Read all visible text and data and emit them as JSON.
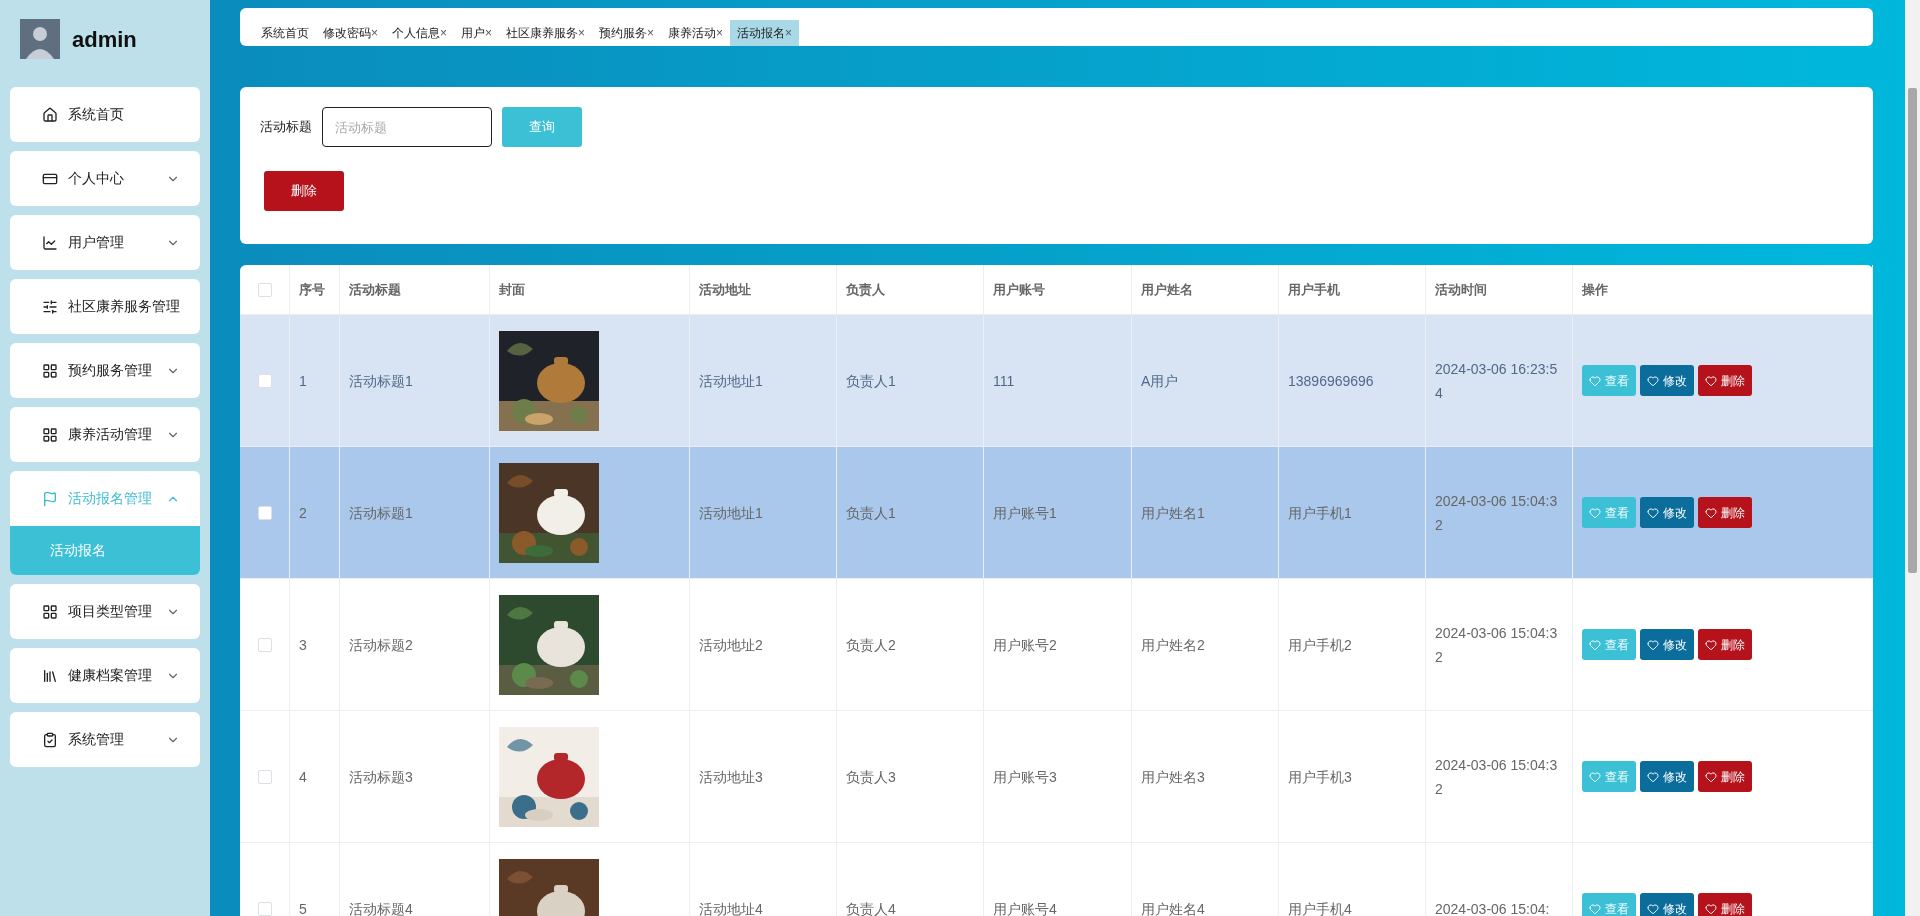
{
  "user": {
    "name": "admin"
  },
  "sidebar": {
    "items": [
      {
        "label": "系统首页",
        "kind": "link",
        "expanded": false
      },
      {
        "label": "个人中心",
        "kind": "menu",
        "expanded": false
      },
      {
        "label": "用户管理",
        "kind": "menu",
        "expanded": false
      },
      {
        "label": "社区康养服务管理",
        "kind": "link",
        "expanded": false
      },
      {
        "label": "预约服务管理",
        "kind": "menu",
        "expanded": false
      },
      {
        "label": "康养活动管理",
        "kind": "menu",
        "expanded": false
      },
      {
        "label": "活动报名管理",
        "kind": "menu",
        "expanded": true,
        "children": [
          {
            "label": "活动报名",
            "selected": true
          }
        ]
      },
      {
        "label": "项目类型管理",
        "kind": "menu",
        "expanded": false
      },
      {
        "label": "健康档案管理",
        "kind": "menu",
        "expanded": false
      },
      {
        "label": "系统管理",
        "kind": "menu",
        "expanded": false
      }
    ]
  },
  "tabs": [
    {
      "label": "系统首页",
      "selected": false
    },
    {
      "label": "修改密码",
      "close": "×",
      "selected": false
    },
    {
      "label": "个人信息",
      "close": "×",
      "selected": false
    },
    {
      "label": "用户",
      "close": "×",
      "selected": false
    },
    {
      "label": "社区康养服务",
      "close": "×",
      "selected": false
    },
    {
      "label": "预约服务",
      "close": "×",
      "selected": false
    },
    {
      "label": "康养活动",
      "close": "×",
      "selected": false
    },
    {
      "label": "活动报名",
      "close": "×",
      "selected": true
    }
  ],
  "search": {
    "label": "活动标题",
    "placeholder": "活动标题",
    "button": "查询",
    "delete_button": "删除"
  },
  "table": {
    "columns": [
      "序号",
      "活动标题",
      "封面",
      "活动地址",
      "负责人",
      "用户账号",
      "用户姓名",
      "用户手机",
      "活动时间",
      "操作"
    ],
    "header_checked": false,
    "rows": [
      {
        "checked": false,
        "hovered": true,
        "selected": false,
        "cells": [
          "1",
          "活动标题1",
          "",
          "活动地址1",
          "负责人1",
          "111",
          "A用户",
          "13896969696",
          "2024-03-06 16:23:54"
        ],
        "cover": {
          "kind": "picture"
        },
        "actions": [
          {
            "kind": "view",
            "label": "查看"
          },
          {
            "kind": "edit",
            "label": "修改"
          },
          {
            "kind": "delete",
            "label": "删除"
          }
        ]
      },
      {
        "checked": false,
        "hovered": false,
        "selected": true,
        "cells": [
          "2",
          "活动标题1",
          "",
          "活动地址1",
          "负责人1",
          "用户账号1",
          "用户姓名1",
          "用户手机1",
          "2024-03-06 15:04:32"
        ],
        "cover": {
          "kind": "picture"
        },
        "actions": [
          {
            "kind": "view",
            "label": "查看"
          },
          {
            "kind": "edit",
            "label": "修改"
          },
          {
            "kind": "delete",
            "label": "删除"
          }
        ]
      },
      {
        "checked": false,
        "hovered": false,
        "selected": false,
        "cells": [
          "3",
          "活动标题2",
          "",
          "活动地址2",
          "负责人2",
          "用户账号2",
          "用户姓名2",
          "用户手机2",
          "2024-03-06 15:04:32"
        ],
        "cover": {
          "kind": "picture"
        },
        "actions": [
          {
            "kind": "view",
            "label": "查看"
          },
          {
            "kind": "edit",
            "label": "修改"
          },
          {
            "kind": "delete",
            "label": "删除"
          }
        ]
      },
      {
        "checked": false,
        "hovered": false,
        "selected": false,
        "cells": [
          "4",
          "活动标题3",
          "",
          "活动地址3",
          "负责人3",
          "用户账号3",
          "用户姓名3",
          "用户手机3",
          "2024-03-06 15:04:32"
        ],
        "cover": {
          "kind": "picture"
        },
        "actions": [
          {
            "kind": "view",
            "label": "查看"
          },
          {
            "kind": "edit",
            "label": "修改"
          },
          {
            "kind": "delete",
            "label": "删除"
          }
        ]
      },
      {
        "checked": false,
        "hovered": false,
        "selected": false,
        "cells": [
          "5",
          "活动标题4",
          "",
          "活动地址4",
          "负责人4",
          "用户账号4",
          "用户姓名4",
          "用户手机4",
          "2024-03-06 15:04:"
        ],
        "cover": {
          "kind": "picture"
        },
        "actions": [
          {
            "kind": "view",
            "label": "查看"
          },
          {
            "kind": "edit",
            "label": "修改"
          },
          {
            "kind": "delete",
            "label": "删除"
          }
        ]
      }
    ]
  }
}
